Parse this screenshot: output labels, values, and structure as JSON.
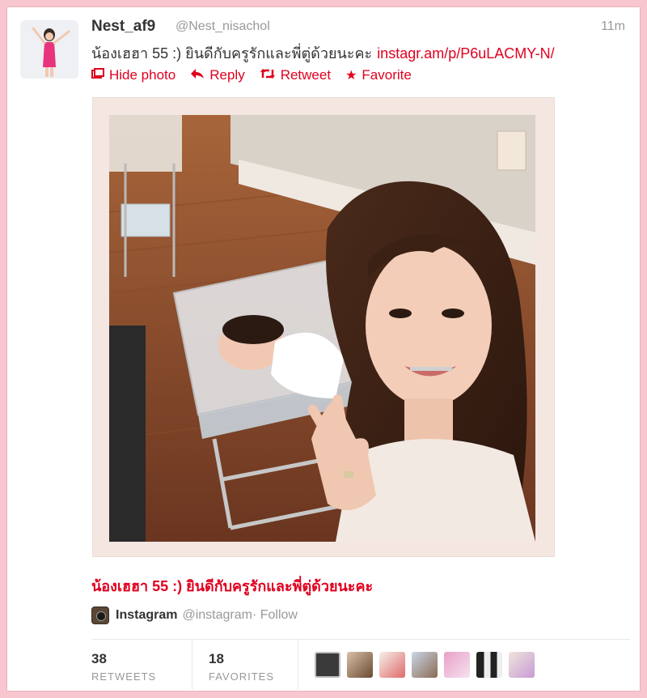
{
  "tweet": {
    "display_name": "Nest_af9",
    "handle": "@Nest_nisachol",
    "time": "11m",
    "text": "น้องเฮฮา 55 :) ยินดีกับครูรักและพี่ตู่ด้วยนะคะ",
    "link": "instagr.am/p/P6uLACMY-N/"
  },
  "actions": {
    "hide_photo": "Hide photo",
    "reply": "Reply",
    "retweet": "Retweet",
    "favorite": "Favorite"
  },
  "media": {
    "caption": "น้องเฮฮา 55 :) ยินดีกับครูรักและพี่ตู่ด้วยนะคะ",
    "source_name": "Instagram",
    "source_handle": "@instagram",
    "follow": "· Follow"
  },
  "stats": {
    "retweets_count": "38",
    "retweets_label": "RETWEETS",
    "favorites_count": "18",
    "favorites_label": "FAVORITES"
  },
  "colors": {
    "accent": "#e0001f",
    "page_bg": "#f7c6cf"
  },
  "icons": {
    "hide_photo": "photo-icon",
    "reply": "reply-arrow-icon",
    "retweet": "retweet-icon",
    "favorite": "star-icon"
  }
}
